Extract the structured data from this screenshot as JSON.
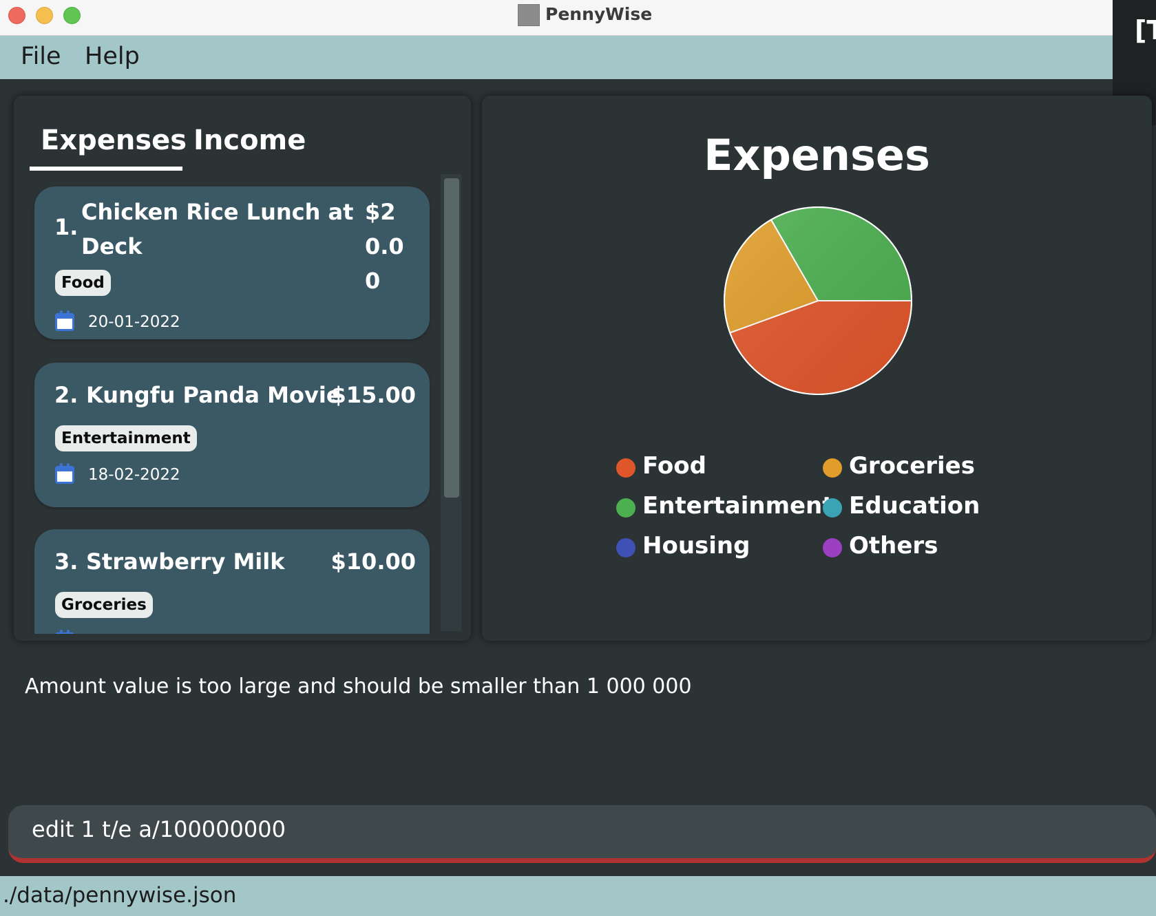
{
  "window": {
    "title": "PennyWise",
    "side_overlay_text": "[T"
  },
  "menu": {
    "file": "File",
    "help": "Help"
  },
  "tabs": {
    "expenses": "Expenses",
    "income": "Income",
    "selected": "Expenses"
  },
  "entries": [
    {
      "index": "1.",
      "description": "Chicken Rice Lunch at Deck",
      "amount": "$20.00",
      "category": "Food",
      "date": "20-01-2022"
    },
    {
      "index": "2.",
      "description": "Kungfu Panda Movie",
      "amount": "$15.00",
      "category": "Entertainment",
      "date": "18-02-2022"
    },
    {
      "index": "3.",
      "description": "Strawberry Milk",
      "amount": "$10.00",
      "category": "Groceries",
      "date": ""
    }
  ],
  "chart_data": {
    "type": "pie",
    "title": "Expenses",
    "categories": [
      "Food",
      "Groceries",
      "Entertainment",
      "Education",
      "Housing",
      "Others"
    ],
    "values": [
      20.0,
      10.0,
      15.0,
      0,
      0,
      0
    ],
    "colors": [
      "#e0562b",
      "#e09d2a",
      "#4caf50",
      "#3aa3b5",
      "#3f51b5",
      "#9c3fc0"
    ],
    "legend": "bottom"
  },
  "result_message": "Amount value is too large and should be smaller than 1 000 000",
  "command": {
    "value": "edit 1 t/e a/100000000",
    "state": "error"
  },
  "status": {
    "file_path": "./data/pennywise.json"
  },
  "colors": {
    "menu_bg": "#a3c7c9",
    "card_bg": "#3b5964",
    "panel_bg": "#2c3335",
    "error_underline": "#b03331"
  }
}
